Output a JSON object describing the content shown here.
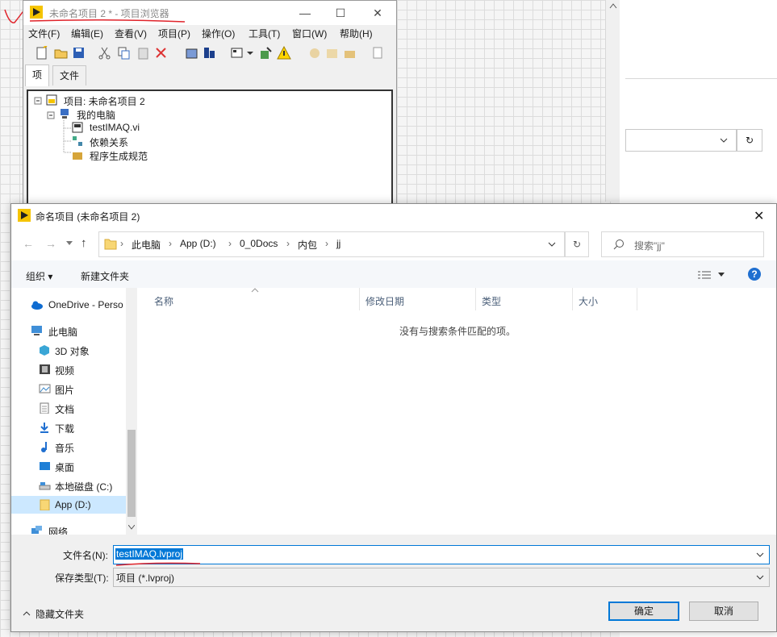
{
  "project_window": {
    "title": "未命名项目 2 * - 项目浏览器",
    "minimize": "—",
    "maximize": "☐",
    "close": "✕",
    "menu": [
      "文件(F)",
      "编辑(E)",
      "查看(V)",
      "项目(P)",
      "操作(O)",
      "工具(T)",
      "窗口(W)",
      "帮助(H)"
    ],
    "tabs": [
      "项",
      "文件"
    ],
    "tree": {
      "root": "项目: 未命名项目 2",
      "computer": "我的电脑",
      "vi": "testIMAQ.vi",
      "deps": "依赖关系",
      "build": "程序生成规范"
    }
  },
  "dialog": {
    "title": "命名项目 (未命名项目 2)",
    "close": "✕",
    "breadcrumb": [
      "此电脑",
      "App (D:)",
      "0_0Docs",
      "内包",
      "jj"
    ],
    "search_placeholder": "搜索\"jj\"",
    "organize": "组织 ▾",
    "new_folder": "新建文件夹",
    "help": "?",
    "nav_items": [
      {
        "label": "OneDrive - Perso",
        "icon": "cloud-icon"
      },
      {
        "label": "此电脑",
        "icon": "computer-icon"
      },
      {
        "label": "3D 对象",
        "icon": "cube-icon"
      },
      {
        "label": "视频",
        "icon": "video-icon"
      },
      {
        "label": "图片",
        "icon": "picture-icon"
      },
      {
        "label": "文档",
        "icon": "document-icon"
      },
      {
        "label": "下载",
        "icon": "download-icon"
      },
      {
        "label": "音乐",
        "icon": "music-icon"
      },
      {
        "label": "桌面",
        "icon": "desktop-icon"
      },
      {
        "label": "本地磁盘 (C:)",
        "icon": "drive-icon"
      },
      {
        "label": "App (D:)",
        "icon": "folder-icon"
      },
      {
        "label": "网络",
        "icon": "network-icon"
      }
    ],
    "columns": [
      "名称",
      "修改日期",
      "类型",
      "大小"
    ],
    "empty_message": "没有与搜索条件匹配的项。",
    "filename_label": "文件名(N):",
    "filename_value": "testIMAQ.lvproj",
    "filetype_label": "保存类型(T):",
    "filetype_value": "项目 (*.lvproj)",
    "hide_folders": "隐藏文件夹",
    "ok": "确定",
    "cancel": "取消"
  },
  "colors": {
    "accent": "#0078d7",
    "annotation": "#e0242b"
  }
}
